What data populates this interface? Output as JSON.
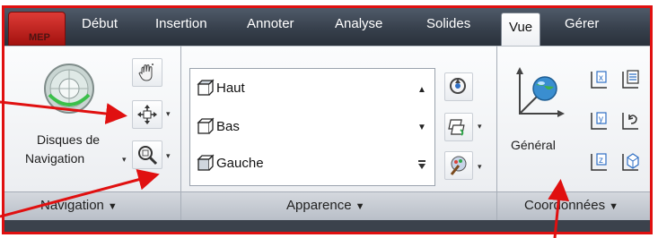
{
  "app_button": {
    "label": "MEP"
  },
  "tabs": [
    {
      "label": "Début"
    },
    {
      "label": "Insertion"
    },
    {
      "label": "Annoter"
    },
    {
      "label": "Analyse"
    },
    {
      "label": "Solides"
    },
    {
      "label": "Vue",
      "active": true
    },
    {
      "label": "Gérer"
    }
  ],
  "navigation_panel": {
    "title": "Navigation",
    "wheel_label_line1": "Disques de",
    "wheel_label_line2": "Navigation"
  },
  "appearance_panel": {
    "title": "Apparence",
    "views": [
      "Haut",
      "Bas",
      "Gauche"
    ]
  },
  "coordinates_panel": {
    "title": "Coordonnées",
    "general_label": "Général"
  },
  "colors": {
    "tabbar": "#37404c",
    "annotation_red": "#e01010",
    "ribbon_bg": "#f4f5f7"
  }
}
